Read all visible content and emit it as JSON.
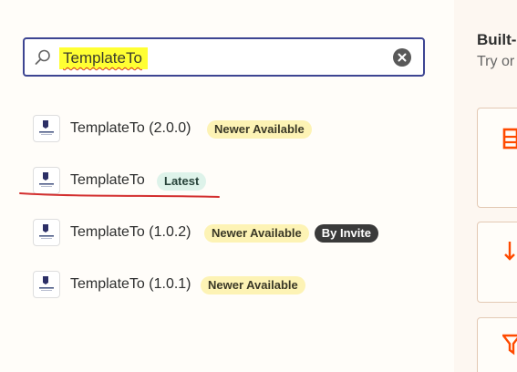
{
  "search": {
    "value": "TemplateTo",
    "icon": "search-icon",
    "clear_icon": "clear-icon"
  },
  "results": [
    {
      "name": "TemplateTo (2.0.0)",
      "badges": [
        {
          "text": "Newer Available",
          "tone": "yellow"
        }
      ]
    },
    {
      "name": "TemplateTo",
      "badges": [
        {
          "text": "Latest",
          "tone": "green"
        }
      ]
    },
    {
      "name": "TemplateTo (1.0.2)",
      "badges": [
        {
          "text": "Newer Available",
          "tone": "yellow"
        },
        {
          "text": "By Invite",
          "tone": "dark"
        }
      ]
    },
    {
      "name": "TemplateTo (1.0.1)",
      "badges": [
        {
          "text": "Newer Available",
          "tone": "yellow"
        }
      ]
    }
  ],
  "right_panel": {
    "title": "Built-",
    "subtitle": "Try or",
    "cards": [
      {
        "icon": "table-icon"
      },
      {
        "icon": "sort-arrows-icon"
      },
      {
        "icon": "filter-icon"
      }
    ]
  },
  "colors": {
    "search_border": "#3d4592",
    "highlight": "#ffff33",
    "annotation_red": "#d32f2f",
    "accent_orange": "#ff4a00",
    "badge_yellow": "#fdf3b5",
    "badge_green": "#def3ea",
    "badge_dark": "#3a3a3a"
  }
}
